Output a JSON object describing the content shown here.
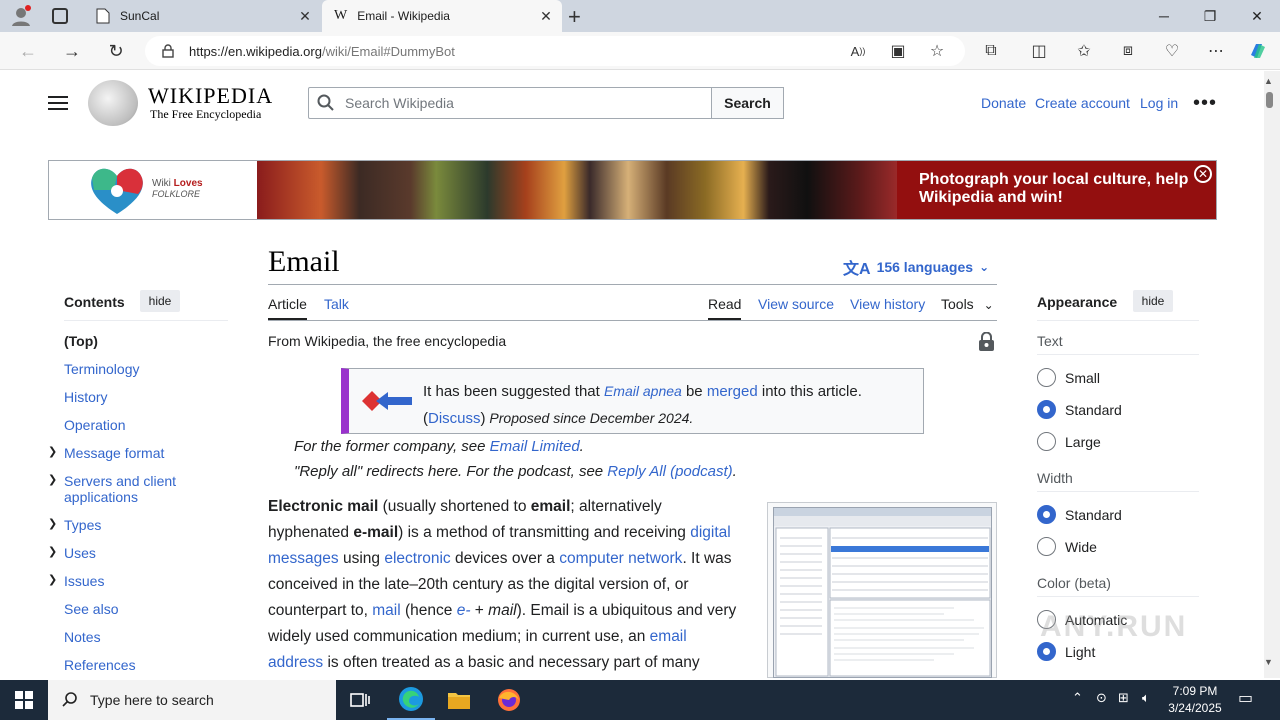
{
  "browser": {
    "tabs": [
      {
        "label": "SunCal",
        "icon": "page-icon"
      },
      {
        "label": "Email - Wikipedia",
        "icon": "wikipedia-icon"
      }
    ],
    "new_tab_symbol": "+",
    "url_host": "https://en.wikipedia.org",
    "url_path": "/wiki/Email#DummyBot"
  },
  "wiki": {
    "wordmark": "WIKIPEDIA",
    "tagline": "The Free Encyclopedia",
    "search_placeholder": "Search Wikipedia",
    "search_button": "Search",
    "top_links": [
      "Donate",
      "Create account",
      "Log in"
    ],
    "more_symbol": "•••"
  },
  "banner": {
    "logo_wiki": "Wiki",
    "logo_loves": "Loves",
    "logo_folklore": "FOLKLORE",
    "text": "Photograph your local culture, help Wikipedia and win!"
  },
  "article": {
    "title": "Email",
    "languages": "156 languages",
    "tabs_left": [
      "Article",
      "Talk"
    ],
    "tabs_right": [
      "Read",
      "View source",
      "View history",
      "Tools"
    ],
    "from": "From Wikipedia, the free encyclopedia",
    "merge": {
      "t1": "It has been suggested that ",
      "link1": "Email apnea",
      "t2": " be ",
      "link2": "merged",
      "t3": " into this article.",
      "discuss_open": "(",
      "discuss": "Discuss",
      "discuss_close": ")",
      "proposed": " Proposed since December 2024."
    },
    "hatnote1": {
      "text": "For the former company, see ",
      "link": "Email Limited",
      "end": "."
    },
    "hatnote2": {
      "text": "\"Reply all\" redirects here. For the podcast, see ",
      "link": "Reply All (podcast)",
      "end": "."
    },
    "body": {
      "b1": "Electronic mail",
      "t1": " (usually shortened to ",
      "b2": "email",
      "t2": "; alternatively hyphenated ",
      "b3": "e-mail",
      "t3": ") is a method of transmitting and receiving ",
      "l1": "digital messages",
      "t4": " using ",
      "l2": "electronic",
      "t5": " devices over a ",
      "l3": "computer network",
      "t6": ". It was conceived in the late–20th century as the digital version of, or counterpart to, ",
      "l4": "mail",
      "t7": " (hence ",
      "l5": "e-",
      "t8": " + ",
      "i1": "mail",
      "t9": "). Email is a ubiquitous and very widely used communication medium; in current use, an ",
      "l6": "email address",
      "t10": " is often treated as a basic and necessary part of many processes in"
    }
  },
  "toc": {
    "heading": "Contents",
    "hide": "hide",
    "items": [
      "(Top)",
      "Terminology",
      "History",
      "Operation",
      "Message format",
      "Servers and client applications",
      "Types",
      "Uses",
      "Issues",
      "See also",
      "Notes",
      "References"
    ]
  },
  "appearance": {
    "heading": "Appearance",
    "hide": "hide",
    "text_label": "Text",
    "text_options": [
      "Small",
      "Standard",
      "Large"
    ],
    "text_selected": "Standard",
    "width_label": "Width",
    "width_options": [
      "Standard",
      "Wide"
    ],
    "width_selected": "Standard",
    "color_label": "Color (beta)",
    "color_options": [
      "Automatic",
      "Light"
    ],
    "color_selected": "Light"
  },
  "watermark": "ANY.RUN",
  "taskbar": {
    "search_placeholder": "Type here to search",
    "time": "7:09 PM",
    "date": "3/24/2025"
  }
}
